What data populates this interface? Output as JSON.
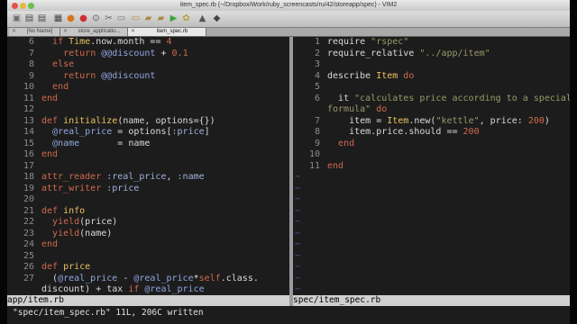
{
  "window": {
    "title": "item_spec.rb (~/Dropbox/Work/ruby_screencasts/ru/42/storeapp/spec) - VIM2"
  },
  "toolbar": [
    {
      "name": "open-file-icon",
      "glyph": "▣",
      "color": "#6d6d6d"
    },
    {
      "name": "save-icon",
      "glyph": "▤",
      "color": "#4a4a4a"
    },
    {
      "name": "save-all-icon",
      "glyph": "▤",
      "color": "#4a4a4a"
    },
    {
      "name": "print-icon",
      "glyph": "▦",
      "color": "#444444"
    },
    {
      "name": "undo-icon",
      "glyph": "●",
      "color": "#d9731e"
    },
    {
      "name": "redo-icon",
      "glyph": "●",
      "color": "#cf2f2f"
    },
    {
      "name": "find-icon",
      "glyph": "⊙",
      "color": "#555555"
    },
    {
      "name": "cut-icon",
      "glyph": "✂",
      "color": "#666666"
    },
    {
      "name": "copy-icon",
      "glyph": "▭",
      "color": "#777777"
    },
    {
      "name": "paste-icon",
      "glyph": "▭",
      "color": "#b08a3c"
    },
    {
      "name": "find-replace-icon",
      "glyph": "▰",
      "color": "#a98a44"
    },
    {
      "name": "load-session-icon",
      "glyph": "▰",
      "color": "#a98a44"
    },
    {
      "name": "save-session-icon",
      "glyph": "▶",
      "color": "#3ea13e"
    },
    {
      "name": "run-script-icon",
      "glyph": "✿",
      "color": "#b8a23a"
    },
    {
      "name": "make-icon",
      "glyph": "▲",
      "color": "#555555"
    },
    {
      "name": "help-icon",
      "glyph": "◆",
      "color": "#444444"
    }
  ],
  "tabs": [
    {
      "label": "[No Name]",
      "active": false
    },
    {
      "label": "store_applicatio...",
      "active": false
    },
    {
      "label": "item_spec.rb",
      "active": true
    }
  ],
  "left_pane": {
    "filename": "app/item.rb",
    "lines": [
      {
        "n": "6",
        "code": [
          [
            "",
            "  "
          ],
          [
            "kw",
            "if "
          ],
          [
            "cls",
            "Time"
          ],
          [
            "plain",
            ".now.month == "
          ],
          [
            "num",
            "4"
          ]
        ]
      },
      {
        "n": "7",
        "code": [
          [
            "",
            "    "
          ],
          [
            "kw",
            "return "
          ],
          [
            "var",
            "@@discount"
          ],
          [
            "plain",
            " + "
          ],
          [
            "num",
            "0.1"
          ]
        ]
      },
      {
        "n": "8",
        "code": [
          [
            "",
            "  "
          ],
          [
            "kw",
            "else"
          ]
        ]
      },
      {
        "n": "9",
        "code": [
          [
            "",
            "    "
          ],
          [
            "kw",
            "return "
          ],
          [
            "var",
            "@@discount"
          ]
        ]
      },
      {
        "n": "10",
        "code": [
          [
            "",
            "  "
          ],
          [
            "kw",
            "end"
          ]
        ]
      },
      {
        "n": "11",
        "code": [
          [
            "kw",
            "end"
          ]
        ]
      },
      {
        "n": "12",
        "code": []
      },
      {
        "n": "13",
        "code": [
          [
            "kw",
            "def "
          ],
          [
            "cls",
            "initialize"
          ],
          [
            "plain",
            "(name, options={})"
          ]
        ]
      },
      {
        "n": "14",
        "code": [
          [
            "",
            "  "
          ],
          [
            "var",
            "@real_price"
          ],
          [
            "plain",
            " = options["
          ],
          [
            "sym",
            ":price"
          ],
          [
            "plain",
            "]"
          ]
        ]
      },
      {
        "n": "15",
        "code": [
          [
            "",
            "  "
          ],
          [
            "var",
            "@name"
          ],
          [
            "plain",
            "       = name"
          ]
        ]
      },
      {
        "n": "16",
        "code": [
          [
            "kw",
            "end"
          ]
        ]
      },
      {
        "n": "17",
        "code": []
      },
      {
        "n": "18",
        "code": [
          [
            "kw",
            "attr_reader "
          ],
          [
            "sym",
            ":real_price"
          ],
          [
            "plain",
            ", "
          ],
          [
            "sym",
            ":name"
          ]
        ]
      },
      {
        "n": "19",
        "code": [
          [
            "kw",
            "attr_writer "
          ],
          [
            "sym",
            ":price"
          ]
        ]
      },
      {
        "n": "20",
        "code": []
      },
      {
        "n": "21",
        "code": [
          [
            "kw",
            "def "
          ],
          [
            "cls",
            "info"
          ]
        ]
      },
      {
        "n": "22",
        "code": [
          [
            "",
            "  "
          ],
          [
            "kw",
            "yield"
          ],
          [
            "plain",
            "(price)"
          ]
        ]
      },
      {
        "n": "23",
        "code": [
          [
            "",
            "  "
          ],
          [
            "kw",
            "yield"
          ],
          [
            "plain",
            "(name)"
          ]
        ]
      },
      {
        "n": "24",
        "code": [
          [
            "kw",
            "end"
          ]
        ]
      },
      {
        "n": "25",
        "code": []
      },
      {
        "n": "26",
        "code": [
          [
            "kw",
            "def "
          ],
          [
            "cls",
            "price"
          ]
        ]
      },
      {
        "n": "27",
        "code": [
          [
            "",
            "  ("
          ],
          [
            "var",
            "@real_price"
          ],
          [
            "plain",
            " - "
          ],
          [
            "var",
            "@real_price"
          ],
          [
            "plain",
            "*"
          ],
          [
            "kw",
            "self"
          ],
          [
            "plain",
            ".class."
          ]
        ]
      },
      {
        "n": "",
        "code": [
          [
            "plain",
            "discount) + tax "
          ],
          [
            "kw",
            "if "
          ],
          [
            "var",
            "@real_price"
          ]
        ]
      }
    ]
  },
  "right_pane": {
    "filename": "spec/item_spec.rb",
    "lines": [
      {
        "n": "1",
        "code": [
          [
            "plain",
            "require "
          ],
          [
            "str",
            "\"rspec\""
          ]
        ]
      },
      {
        "n": "2",
        "code": [
          [
            "plain",
            "require_relative "
          ],
          [
            "str",
            "\"../app/item\""
          ]
        ]
      },
      {
        "n": "3",
        "code": []
      },
      {
        "n": "4",
        "code": [
          [
            "plain",
            "describe "
          ],
          [
            "cls",
            "Item"
          ],
          [
            "kw",
            " do"
          ]
        ]
      },
      {
        "n": "5",
        "code": []
      },
      {
        "n": "6",
        "code": [
          [
            "",
            "  "
          ],
          [
            "plain",
            "it "
          ],
          [
            "str",
            "\"calculates price according to a special"
          ]
        ]
      },
      {
        "n": "",
        "code": [
          [
            "str",
            "formula\""
          ],
          [
            "kw",
            " do"
          ]
        ]
      },
      {
        "n": "7",
        "code": [
          [
            "",
            "    "
          ],
          [
            "plain",
            "item = "
          ],
          [
            "cls",
            "Item"
          ],
          [
            "plain",
            ".new("
          ],
          [
            "str",
            "\"kettle\""
          ],
          [
            "plain",
            ", price: "
          ],
          [
            "num",
            "200"
          ],
          [
            "plain",
            ")"
          ]
        ]
      },
      {
        "n": "8",
        "code": [
          [
            "",
            "    "
          ],
          [
            "plain",
            "item.price.should == "
          ],
          [
            "num",
            "200"
          ]
        ]
      },
      {
        "n": "9",
        "code": [
          [
            "",
            "  "
          ],
          [
            "kw",
            "end"
          ]
        ]
      },
      {
        "n": "10",
        "code": []
      },
      {
        "n": "11",
        "code": [
          [
            "kw",
            "end"
          ]
        ]
      }
    ],
    "tilde_count": 11
  },
  "command_line": "\"spec/item_spec.rb\" 11L, 206C written",
  "tilde_char": "~"
}
